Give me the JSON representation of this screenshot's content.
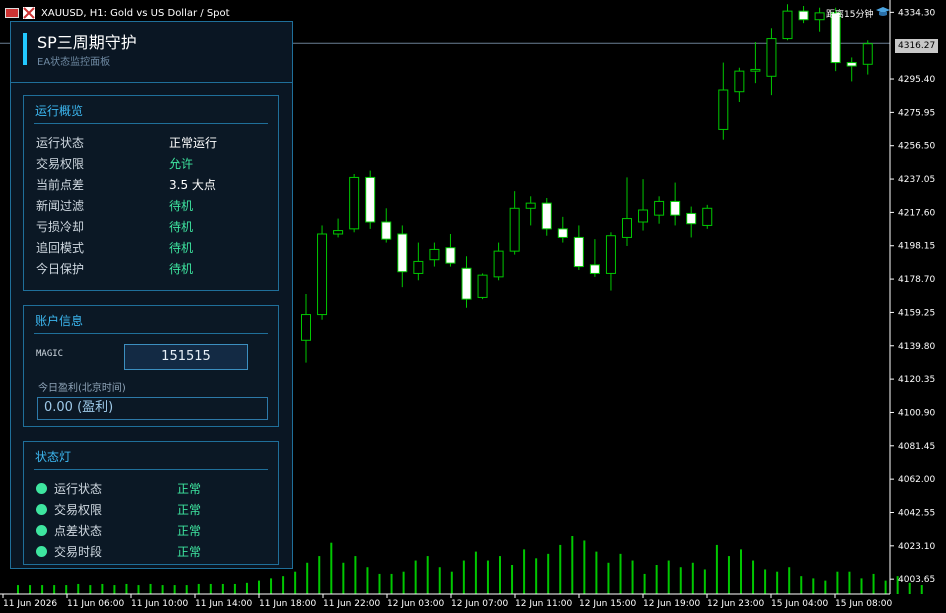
{
  "chart_header": {
    "title": "XAUUSD, H1:  Gold vs US Dollar / Spot",
    "timer": "距离15分钟",
    "current_price_tag": "4316.27"
  },
  "panel": {
    "title": "SP三周期守护",
    "subtitle": "EA状态监控面板",
    "overview": {
      "heading": "运行概览",
      "rows": [
        {
          "label": "运行状态",
          "value": "正常运行"
        },
        {
          "label": "交易权限",
          "value": "允许"
        },
        {
          "label": "当前点差",
          "value": "3.5 大点"
        },
        {
          "label": "新闻过滤",
          "value": "待机"
        },
        {
          "label": "亏损冷却",
          "value": "待机"
        },
        {
          "label": "追回模式",
          "value": "待机"
        },
        {
          "label": "今日保护",
          "value": "待机"
        }
      ]
    },
    "account": {
      "heading": "账户信息",
      "magic_label": "MAGIC",
      "magic_value": "151515",
      "pnl_label": "今日盈利(北京时间)",
      "pnl_value": "0.00  (盈利)"
    },
    "lamps": {
      "heading": "状态灯",
      "items": [
        {
          "label": "运行状态",
          "value": "正常"
        },
        {
          "label": "交易权限",
          "value": "正常"
        },
        {
          "label": "点差状态",
          "value": "正常"
        },
        {
          "label": "交易时段",
          "value": "正常"
        }
      ]
    }
  },
  "colors": {
    "background": "#000000",
    "bull_candle": "#000000",
    "bear_candle": "#ffffff",
    "wick": "#00c800",
    "volume": "#00c800",
    "panel_bg": "#0a1623",
    "panel_border": "#1f6f9a",
    "accent": "#22c8ff",
    "ok_green": "#3ee6a0"
  },
  "chart_data": {
    "type": "candlestick",
    "symbol": "XAUUSD",
    "timeframe": "H1",
    "price_axis_labels": [
      "4334.30",
      "4316.27",
      "4295.40",
      "4275.95",
      "4256.50",
      "4237.05",
      "4217.60",
      "4198.15",
      "4178.70",
      "4159.25",
      "4139.80",
      "4120.35",
      "4100.90",
      "4081.45",
      "4062.00",
      "4042.55",
      "4023.10",
      "4003.65"
    ],
    "time_axis_labels": [
      "11 Jun 2026",
      "11 Jun 06:00",
      "11 Jun 10:00",
      "11 Jun 14:00",
      "11 Jun 18:00",
      "11 Jun 22:00",
      "12 Jun 03:00",
      "12 Jun 07:00",
      "12 Jun 11:00",
      "12 Jun 15:00",
      "12 Jun 19:00",
      "12 Jun 23:00",
      "15 Jun 04:00",
      "15 Jun 08:00"
    ],
    "ylim": [
      3995,
      4338
    ],
    "current_price": 4316.27,
    "candles": [
      {
        "o": 4143,
        "h": 4170,
        "l": 4130,
        "c": 4158
      },
      {
        "o": 4158,
        "h": 4210,
        "l": 4155,
        "c": 4205
      },
      {
        "o": 4205,
        "h": 4214,
        "l": 4203,
        "c": 4207
      },
      {
        "o": 4208,
        "h": 4240,
        "l": 4206,
        "c": 4238
      },
      {
        "o": 4238,
        "h": 4242,
        "l": 4208,
        "c": 4212
      },
      {
        "o": 4212,
        "h": 4220,
        "l": 4200,
        "c": 4202
      },
      {
        "o": 4205,
        "h": 4210,
        "l": 4174,
        "c": 4183
      },
      {
        "o": 4182,
        "h": 4200,
        "l": 4178,
        "c": 4189
      },
      {
        "o": 4190,
        "h": 4200,
        "l": 4186,
        "c": 4196
      },
      {
        "o": 4197,
        "h": 4205,
        "l": 4186,
        "c": 4188
      },
      {
        "o": 4185,
        "h": 4192,
        "l": 4162,
        "c": 4167
      },
      {
        "o": 4168,
        "h": 4182,
        "l": 4167,
        "c": 4181
      },
      {
        "o": 4180,
        "h": 4200,
        "l": 4178,
        "c": 4195
      },
      {
        "o": 4195,
        "h": 4230,
        "l": 4193,
        "c": 4220
      },
      {
        "o": 4220,
        "h": 4227,
        "l": 4210,
        "c": 4223
      },
      {
        "o": 4223,
        "h": 4226,
        "l": 4204,
        "c": 4208
      },
      {
        "o": 4208,
        "h": 4215,
        "l": 4200,
        "c": 4203
      },
      {
        "o": 4203,
        "h": 4210,
        "l": 4184,
        "c": 4186
      },
      {
        "o": 4187,
        "h": 4202,
        "l": 4180,
        "c": 4182
      },
      {
        "o": 4182,
        "h": 4206,
        "l": 4172,
        "c": 4204
      },
      {
        "o": 4203,
        "h": 4238,
        "l": 4198,
        "c": 4214
      },
      {
        "o": 4212,
        "h": 4237,
        "l": 4207,
        "c": 4219
      },
      {
        "o": 4216,
        "h": 4227,
        "l": 4211,
        "c": 4224
      },
      {
        "o": 4224,
        "h": 4235,
        "l": 4210,
        "c": 4216
      },
      {
        "o": 4217,
        "h": 4221,
        "l": 4203,
        "c": 4211
      },
      {
        "o": 4210,
        "h": 4222,
        "l": 4208,
        "c": 4220
      },
      {
        "o": 4266,
        "h": 4305,
        "l": 4260,
        "c": 4289
      },
      {
        "o": 4288,
        "h": 4302,
        "l": 4282,
        "c": 4300
      },
      {
        "o": 4300,
        "h": 4317,
        "l": 4293,
        "c": 4301
      },
      {
        "o": 4297,
        "h": 4325,
        "l": 4286,
        "c": 4319
      },
      {
        "o": 4319,
        "h": 4339,
        "l": 4318,
        "c": 4335
      },
      {
        "o": 4335,
        "h": 4338,
        "l": 4328,
        "c": 4330
      },
      {
        "o": 4330,
        "h": 4337,
        "l": 4323,
        "c": 4334
      },
      {
        "o": 4334,
        "h": 4337,
        "l": 4300,
        "c": 4305
      },
      {
        "o": 4305,
        "h": 4308,
        "l": 4294,
        "c": 4303
      },
      {
        "o": 4304,
        "h": 4318,
        "l": 4298,
        "c": 4316
      }
    ],
    "volumes": [
      8,
      8,
      8,
      8,
      8,
      9,
      8,
      9,
      8,
      9,
      8,
      9,
      8,
      8,
      8,
      9,
      9,
      9,
      9,
      10,
      12,
      14,
      16,
      20,
      28,
      34,
      46,
      28,
      34,
      24,
      18,
      18,
      20,
      30,
      34,
      24,
      20,
      30,
      38,
      30,
      34,
      26,
      40,
      32,
      36,
      44,
      52,
      48,
      38,
      28,
      36,
      30,
      18,
      26,
      30,
      24,
      28,
      22,
      44,
      34,
      40,
      30,
      22,
      20,
      24,
      16,
      14,
      12,
      20,
      20,
      14,
      18,
      12,
      16,
      10,
      8
    ]
  }
}
